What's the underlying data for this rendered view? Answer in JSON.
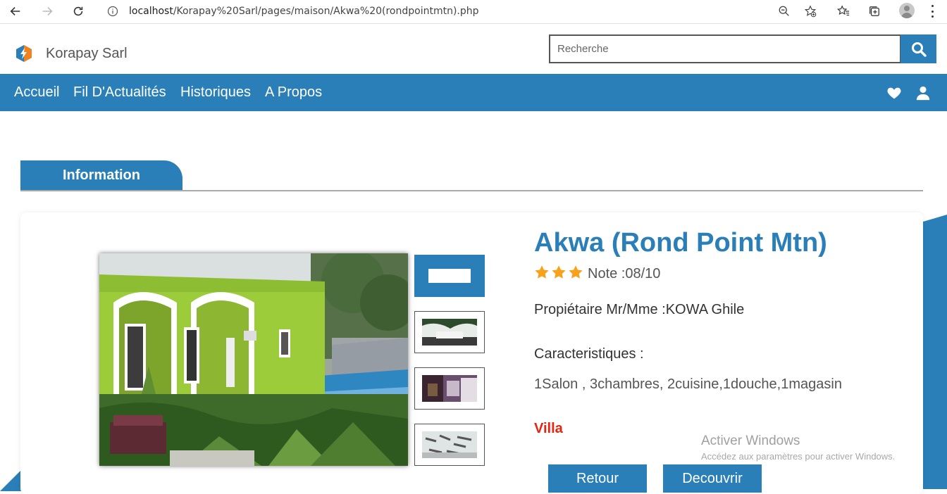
{
  "browser": {
    "url_host": "localhost",
    "url_path": "/Korapay%20Sarl/pages/maison/Akwa%20(rondpointmtn).php"
  },
  "header": {
    "brand": "Korapay Sarl",
    "search_placeholder": "Recherche"
  },
  "nav": {
    "items": [
      "Accueil",
      "Fil D'Actualités",
      "Historiques",
      "A Propos"
    ]
  },
  "tab": {
    "label": "Information"
  },
  "house": {
    "title": "Akwa (Rond Point Mtn)",
    "rating_stars": 3,
    "rating_text": "Note :08/10",
    "owner": "Propiétaire Mr/Mme :KOWA Ghile",
    "features_label": "Caracteristiques :",
    "features": "1Salon , 3chambres, 2cuisine,1douche,1magasin",
    "type": "Villa"
  },
  "buttons": {
    "back": "Retour",
    "discover": "Decouvrir"
  },
  "watermark": {
    "title": "Activer Windows",
    "subtitle": "Accédez aux paramètres pour activer Windows."
  },
  "colors": {
    "primary": "#2a7fb8",
    "accent_red": "#e8230f",
    "star": "#f7a21b"
  }
}
